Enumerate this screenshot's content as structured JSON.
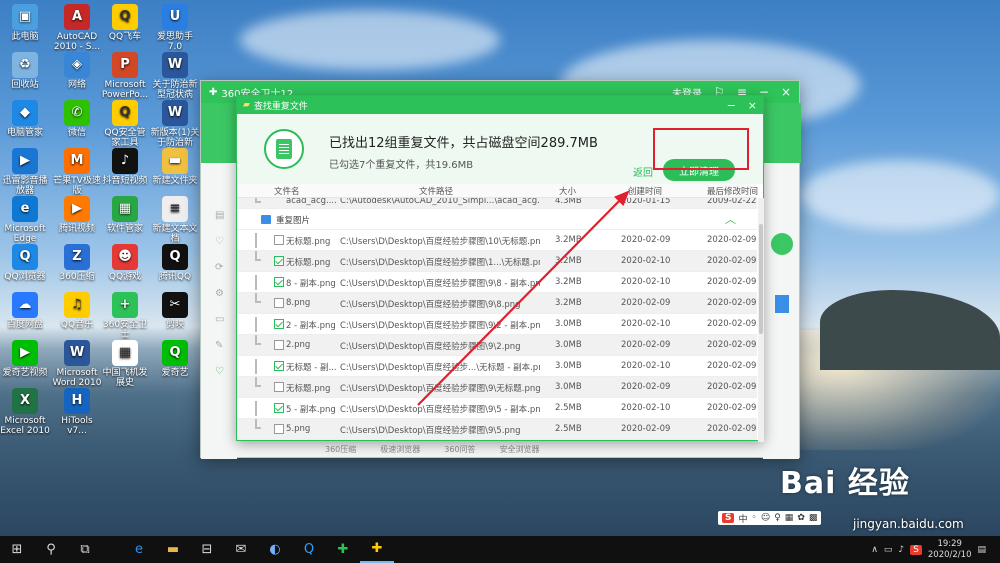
{
  "desktop_icons": [
    {
      "label": "此电脑",
      "color": "#4a9fe0",
      "glyph": "▣"
    },
    {
      "label": "AutoCAD 2010 - S...",
      "color": "#c62828",
      "glyph": "A"
    },
    {
      "label": "QQ飞车",
      "color": "#ffcc00",
      "glyph": "Q"
    },
    {
      "label": "爱思助手7.0",
      "color": "#2a7de1",
      "glyph": "U"
    },
    {
      "label": "回收站",
      "color": "#7fb3e0",
      "glyph": "♻"
    },
    {
      "label": "网络",
      "color": "#3a86d6",
      "glyph": "◈"
    },
    {
      "label": "Microsoft PowerPo...",
      "color": "#d24726",
      "glyph": "P"
    },
    {
      "label": "关于防治新型冠状病毒...",
      "color": "#2b579a",
      "glyph": "W"
    },
    {
      "label": "电脑管家",
      "color": "#1e88e5",
      "glyph": "◆"
    },
    {
      "label": "微信",
      "color": "#2dc100",
      "glyph": "✆"
    },
    {
      "label": "QQ安全管家工具",
      "color": "#ffcc00",
      "glyph": "Q"
    },
    {
      "label": "新版本(1)关于防治新型...",
      "color": "#2b579a",
      "glyph": "W"
    },
    {
      "label": "迅雷影音播放器",
      "color": "#1976d2",
      "glyph": "▶"
    },
    {
      "label": "芒果TV极速版",
      "color": "#ff6f00",
      "glyph": "M"
    },
    {
      "label": "抖音短视频",
      "color": "#111111",
      "glyph": "♪"
    },
    {
      "label": "新建文件夹",
      "color": "#f0c040",
      "glyph": "▬"
    },
    {
      "label": "Microsoft Edge",
      "color": "#0f78d4",
      "glyph": "e"
    },
    {
      "label": "腾讯视频",
      "color": "#ff7a00",
      "glyph": "▶"
    },
    {
      "label": "软件管家",
      "color": "#2aa745",
      "glyph": "▦"
    },
    {
      "label": "新建文本文档",
      "color": "#eeeeee",
      "glyph": "≡"
    },
    {
      "label": "QQ浏览器",
      "color": "#1e88e5",
      "glyph": "Q"
    },
    {
      "label": "360压缩",
      "color": "#2a6fd6",
      "glyph": "Z"
    },
    {
      "label": "QQ游戏",
      "color": "#e53935",
      "glyph": "☻"
    },
    {
      "label": "腾讯QQ",
      "color": "#111111",
      "glyph": "Q"
    },
    {
      "label": "百度网盘",
      "color": "#2979ff",
      "glyph": "☁"
    },
    {
      "label": "QQ音乐",
      "color": "#ffcc00",
      "glyph": "♫"
    },
    {
      "label": "360安全卫士",
      "color": "#2dc159",
      "glyph": "+"
    },
    {
      "label": "剪映",
      "color": "#111111",
      "glyph": "✂"
    },
    {
      "label": "爱奇艺视频",
      "color": "#00be06",
      "glyph": "▶"
    },
    {
      "label": "Microsoft Word 2010",
      "color": "#2b579a",
      "glyph": "W"
    },
    {
      "label": "中国飞机发展史",
      "color": "#ffffff",
      "glyph": "▦"
    },
    {
      "label": "爱奇艺",
      "color": "#00be06",
      "glyph": "Q"
    },
    {
      "label": "Microsoft Excel 2010",
      "color": "#217346",
      "glyph": "X"
    },
    {
      "label": "HiTools v7...",
      "color": "#1565c0",
      "glyph": "H"
    }
  ],
  "main_window": {
    "title": "360安全卫士12",
    "login": "未登录",
    "bottom_items": [
      "360压缩",
      "极速浏览器",
      "360问答",
      "安全浏览器"
    ]
  },
  "dialog": {
    "title": "查找重复文件",
    "summary_main": "已找出12组重复文件，共占磁盘空间289.7MB",
    "summary_sub": "已勾选7个重复文件，共19.6MB",
    "back_label": "返回",
    "clean_label": "立即清理",
    "columns": {
      "name": "文件名",
      "path": "文件路径",
      "size": "大小",
      "ctime": "创建时间",
      "mtime": "最后修改时间"
    },
    "group_label": "重复图片",
    "top_row": {
      "name": "acad_acg....",
      "path": "C:\\Autodesk\\AutoCAD_2010_Simpl...\\acad_acg.pdf",
      "size": "4.3MB",
      "ctime": "2020-01-15",
      "mtime": "2009-02-22"
    },
    "rows": [
      {
        "name": "无标题.png",
        "path": "C:\\Users\\D\\Desktop\\百度经验步骤图\\10\\无标题.png",
        "size": "3.2MB",
        "ctime": "2020-02-09",
        "mtime": "2020-02-09",
        "checked": false,
        "grey": false
      },
      {
        "name": "无标题.png",
        "path": "C:\\Users\\D\\Desktop\\百度经验步骤图\\1...\\无标题.png",
        "size": "3.2MB",
        "ctime": "2020-02-10",
        "mtime": "2020-02-09",
        "checked": true,
        "grey": true
      },
      {
        "name": "8 - 副本.png",
        "path": "C:\\Users\\D\\Desktop\\百度经验步骤图\\9\\8 - 副本.png",
        "size": "3.2MB",
        "ctime": "2020-02-10",
        "mtime": "2020-02-09",
        "checked": true,
        "grey": false
      },
      {
        "name": "8.png",
        "path": "C:\\Users\\D\\Desktop\\百度经验步骤图\\9\\8.png",
        "size": "3.2MB",
        "ctime": "2020-02-09",
        "mtime": "2020-02-09",
        "checked": false,
        "grey": true
      },
      {
        "name": "2 - 副本.png",
        "path": "C:\\Users\\D\\Desktop\\百度经验步骤图\\9\\2 - 副本.png",
        "size": "3.0MB",
        "ctime": "2020-02-10",
        "mtime": "2020-02-09",
        "checked": true,
        "grey": false
      },
      {
        "name": "2.png",
        "path": "C:\\Users\\D\\Desktop\\百度经验步骤图\\9\\2.png",
        "size": "3.0MB",
        "ctime": "2020-02-09",
        "mtime": "2020-02-09",
        "checked": false,
        "grey": true
      },
      {
        "name": "无标题 - 副...",
        "path": "C:\\Users\\D\\Desktop\\百度经验步...\\无标题 - 副本.png",
        "size": "3.0MB",
        "ctime": "2020-02-10",
        "mtime": "2020-02-09",
        "checked": true,
        "grey": false
      },
      {
        "name": "无标题.png",
        "path": "C:\\Users\\D\\Desktop\\百度经验步骤图\\9\\无标题.png",
        "size": "3.0MB",
        "ctime": "2020-02-09",
        "mtime": "2020-02-09",
        "checked": false,
        "grey": true
      },
      {
        "name": "5 - 副本.png",
        "path": "C:\\Users\\D\\Desktop\\百度经验步骤图\\9\\5 - 副本.png",
        "size": "2.5MB",
        "ctime": "2020-02-10",
        "mtime": "2020-02-09",
        "checked": true,
        "grey": false
      },
      {
        "name": "5.png",
        "path": "C:\\Users\\D\\Desktop\\百度经验步骤图\\9\\5.png",
        "size": "2.5MB",
        "ctime": "2020-02-09",
        "mtime": "2020-02-09",
        "checked": false,
        "grey": true
      }
    ]
  },
  "taskbar": {
    "time": "19:29",
    "date": "2020/2/10",
    "ime_lang": "中"
  },
  "watermark": {
    "brand": "Bai 经验",
    "url": "jingyan.baidu.com"
  },
  "colors": {
    "accent": "#2bbd58",
    "highlight": "#e0202e"
  }
}
